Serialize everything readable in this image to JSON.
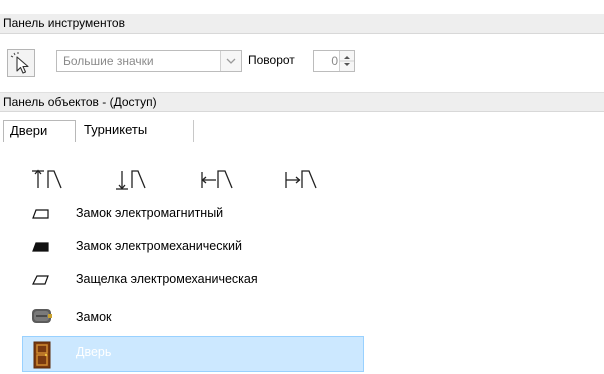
{
  "toolbar_panel": {
    "title": "Панель инструментов",
    "cursor_icon": "pointer-cursor-icon",
    "view_mode": {
      "value": "Большие значки"
    },
    "rotation": {
      "label": "Поворот",
      "value": "0"
    }
  },
  "objects_panel": {
    "title": "Панель объектов - (Доступ)",
    "tabs": [
      {
        "label": "Двери",
        "active": true
      },
      {
        "label": "Турникеты",
        "active": false
      }
    ],
    "door_types": [
      "door-up-arrow-icon",
      "door-down-arrow-icon",
      "door-left-arrow-icon",
      "door-right-arrow-icon"
    ],
    "items": [
      {
        "label": "Замок электромагнитный",
        "icon": "electromagnetic-lock-icon",
        "selected": false
      },
      {
        "label": "Замок электромеханический",
        "icon": "electromechanical-lock-icon",
        "selected": false
      },
      {
        "label": "Защелка электромеханическая",
        "icon": "electromechanical-latch-icon",
        "selected": false
      },
      {
        "label": "Замок",
        "icon": "lock-icon",
        "selected": false
      },
      {
        "label": "Дверь",
        "icon": "door-icon",
        "selected": true
      }
    ],
    "selection_color": "#cce8ff"
  }
}
